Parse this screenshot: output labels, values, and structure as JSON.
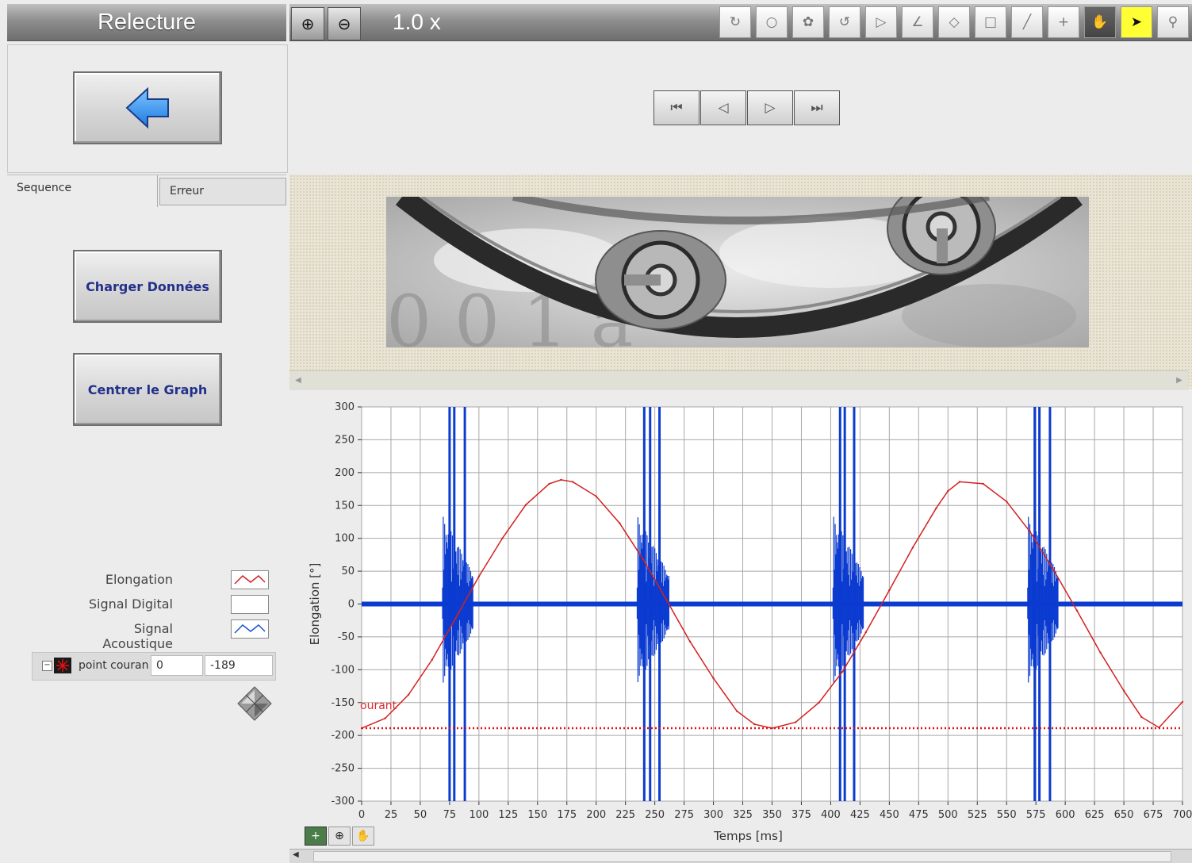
{
  "app": {
    "title": "Relecture",
    "zoom_level": "1.0 x"
  },
  "toolbar": {
    "zoom_in_icon": "zoom-in-icon",
    "zoom_out_icon": "zoom-out-icon",
    "tools": [
      {
        "name": "rotate-tool-icon",
        "glyph": "↻"
      },
      {
        "name": "circle-tool-icon",
        "glyph": "○"
      },
      {
        "name": "freehand-tool-icon",
        "glyph": "✿"
      },
      {
        "name": "lasso-tool-icon",
        "glyph": "↺"
      },
      {
        "name": "polygon-tool-icon",
        "glyph": "▷"
      },
      {
        "name": "angle-tool-icon",
        "glyph": "∠"
      },
      {
        "name": "diamond-tool-icon",
        "glyph": "◇"
      },
      {
        "name": "rectangle-tool-icon",
        "glyph": "□"
      },
      {
        "name": "line-tool-icon",
        "glyph": "╱"
      },
      {
        "name": "point-tool-icon",
        "glyph": "+"
      },
      {
        "name": "pan-hand-icon",
        "glyph": "✋",
        "active": true
      },
      {
        "name": "pointer-arrow-icon",
        "glyph": "➤",
        "highlight": true
      },
      {
        "name": "zoom-tool-icon",
        "glyph": "⚲"
      }
    ]
  },
  "playback": {
    "buttons": [
      {
        "name": "first-frame-button",
        "glyph": "⏮"
      },
      {
        "name": "previous-frame-button",
        "glyph": "◁"
      },
      {
        "name": "next-frame-button",
        "glyph": "▷"
      },
      {
        "name": "last-frame-button",
        "glyph": "⏭"
      }
    ]
  },
  "sidebar": {
    "tabs": [
      {
        "label": "Sequence",
        "active": true
      },
      {
        "label": "Erreur",
        "active": false
      }
    ],
    "load_button": "Charger Données",
    "center_button": "Centrer le Graph"
  },
  "legend": {
    "items": [
      {
        "label": "Elongation",
        "color": "#cc2222"
      },
      {
        "label": "Signal Digital",
        "color": "#ffffff"
      },
      {
        "label": "Signal Acoustique",
        "color": "#1f4fd8"
      }
    ]
  },
  "cursor": {
    "name": "point couran",
    "x": "0",
    "y": "-189",
    "plot_label": "ourant"
  },
  "colors": {
    "elongation": "#d42020",
    "acoustic": "#0b3bd0",
    "cursor_line": "#e01010"
  },
  "chart_data": {
    "type": "line",
    "xlabel": "Temps [ms]",
    "ylabel": "Elongation [°]",
    "xlim": [
      0,
      700
    ],
    "ylim": [
      -300,
      300
    ],
    "xticks": [
      0,
      25,
      50,
      75,
      100,
      125,
      150,
      175,
      200,
      225,
      250,
      275,
      300,
      325,
      350,
      375,
      400,
      425,
      450,
      475,
      500,
      525,
      550,
      575,
      600,
      625,
      650,
      675,
      700
    ],
    "yticks": [
      300,
      250,
      200,
      150,
      100,
      50,
      0,
      -50,
      -100,
      -150,
      -200,
      -250,
      -300
    ],
    "grid": true,
    "series": [
      {
        "name": "Elongation",
        "x": [
          0,
          20,
          40,
          60,
          80,
          100,
          120,
          140,
          160,
          170,
          180,
          200,
          220,
          240,
          260,
          280,
          300,
          320,
          335,
          350,
          370,
          390,
          410,
          430,
          450,
          470,
          490,
          500,
          510,
          530,
          550,
          570,
          590,
          610,
          630,
          650,
          665,
          680,
          700
        ],
        "y": [
          -189,
          -174,
          -138,
          -85,
          -22,
          42,
          100,
          151,
          183,
          189,
          186,
          164,
          123,
          68,
          6,
          -57,
          -113,
          -163,
          -183,
          -189,
          -180,
          -150,
          -103,
          -43,
          21,
          86,
          146,
          172,
          186,
          183,
          156,
          110,
          52,
          -10,
          -74,
          -132,
          -172,
          -188,
          -149
        ]
      },
      {
        "name": "Signal Acoustique",
        "baseline": 0,
        "bursts": [
          {
            "x": 75,
            "min": -300,
            "max": 300
          },
          {
            "x": 79,
            "min": -300,
            "max": 300
          },
          {
            "x": 88,
            "min": -300,
            "max": 300
          },
          {
            "x": 241,
            "min": -300,
            "max": 300
          },
          {
            "x": 246,
            "min": -300,
            "max": 300
          },
          {
            "x": 254,
            "min": -300,
            "max": 300
          },
          {
            "x": 408,
            "min": -300,
            "max": 300
          },
          {
            "x": 412,
            "min": -300,
            "max": 300
          },
          {
            "x": 420,
            "min": -300,
            "max": 300
          },
          {
            "x": 574,
            "min": -300,
            "max": 300
          },
          {
            "x": 578,
            "min": -300,
            "max": 300
          },
          {
            "x": 587,
            "min": -300,
            "max": 300
          }
        ]
      }
    ],
    "cursor": {
      "y": -189
    }
  }
}
